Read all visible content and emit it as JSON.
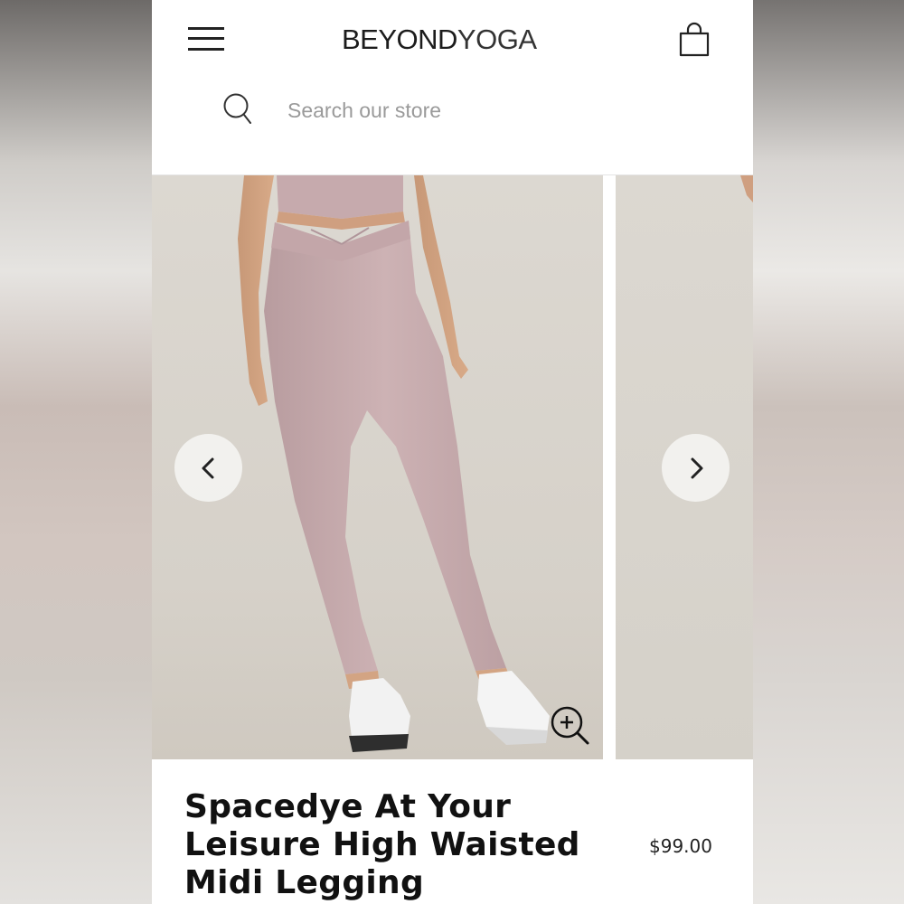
{
  "header": {
    "logo_bold": "BEYOND",
    "logo_light": "YOGA",
    "menu_icon": "hamburger-menu-icon",
    "cart_icon": "shopping-bag-icon"
  },
  "search": {
    "placeholder": "Search our store",
    "icon": "search-icon"
  },
  "gallery": {
    "prev_icon": "chevron-left-icon",
    "next_icon": "chevron-right-icon",
    "zoom_icon": "zoom-in-icon"
  },
  "product": {
    "title": "Spacedye At Your Leisure High Waisted Midi Legging",
    "price": "$99.00"
  },
  "colors": {
    "legging": "#c9aeb0",
    "background": "#d9d4cc",
    "text": "#111111"
  }
}
